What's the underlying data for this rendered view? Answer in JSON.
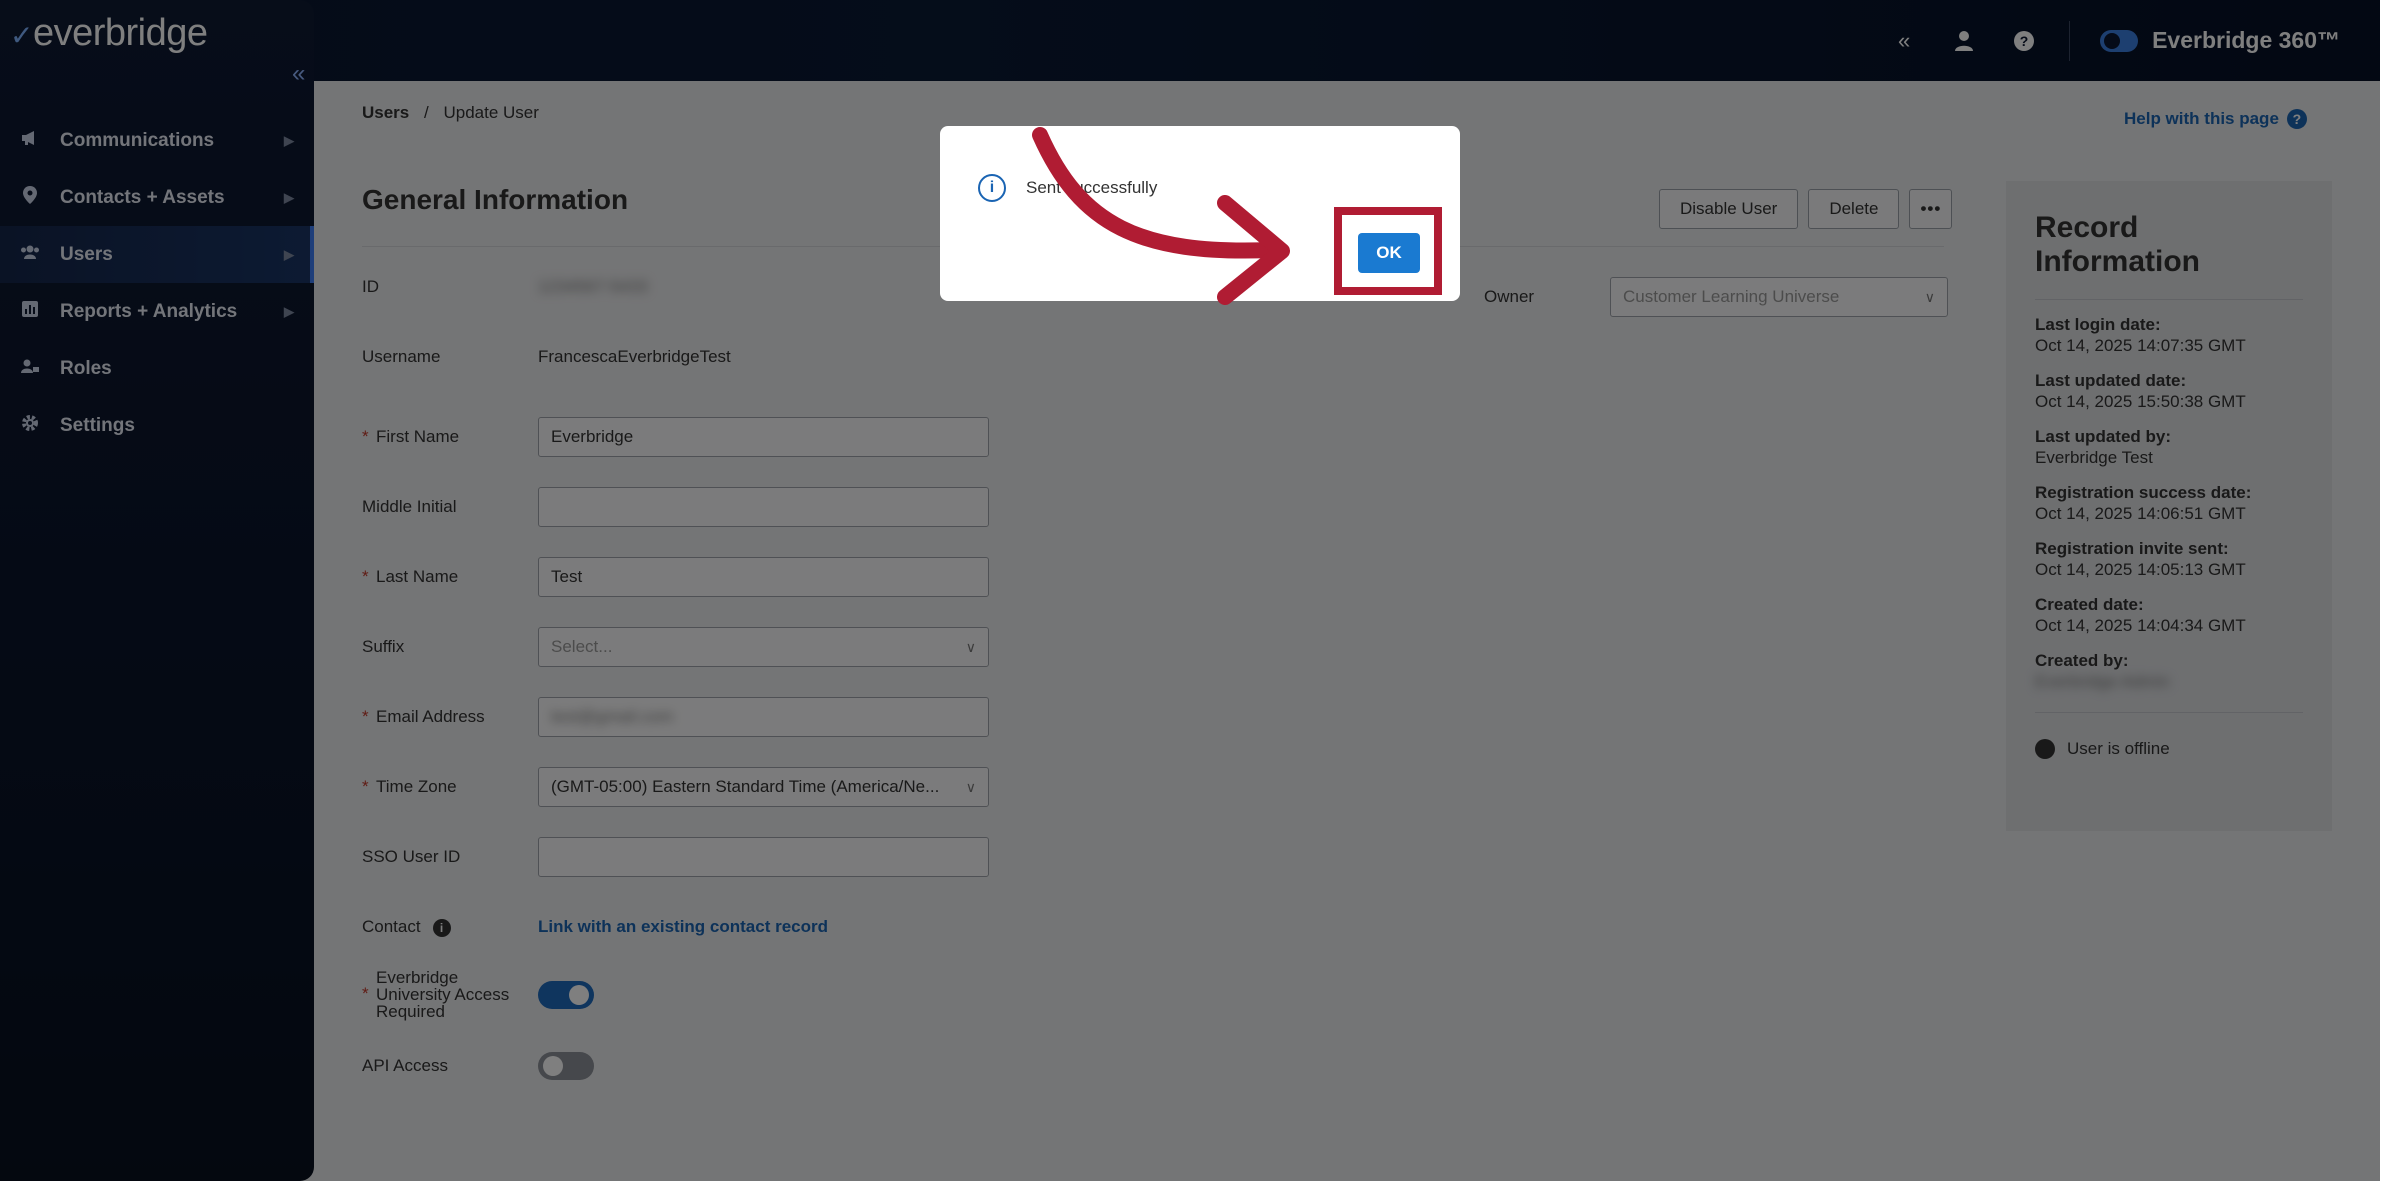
{
  "brand": {
    "logo_text": "everbridge"
  },
  "topbar": {
    "product_label": "Everbridge 360™"
  },
  "sidebar": {
    "items": [
      {
        "label": "Communications",
        "icon": "megaphone-icon",
        "has_children": true
      },
      {
        "label": "Contacts + Assets",
        "icon": "location-pin-icon",
        "has_children": true
      },
      {
        "label": "Users",
        "icon": "users-icon",
        "has_children": true,
        "active": true
      },
      {
        "label": "Reports + Analytics",
        "icon": "chart-icon",
        "has_children": true
      },
      {
        "label": "Roles",
        "icon": "user-role-icon",
        "has_children": false
      },
      {
        "label": "Settings",
        "icon": "gear-icon",
        "has_children": false
      }
    ]
  },
  "breadcrumb": {
    "root": "Users",
    "separator": "/",
    "current": "Update User"
  },
  "help": {
    "label": "Help with this page"
  },
  "section": {
    "title": "General Information"
  },
  "actions": {
    "disable": "Disable User",
    "delete": "Delete",
    "more": "•••"
  },
  "form": {
    "id_label": "ID",
    "id_value": "1234567-5433",
    "owner_label": "Owner",
    "owner_value": "Customer Learning Universe",
    "username_label": "Username",
    "username_value": "FrancescaEverbridgeTest",
    "first_name_label": "First Name",
    "first_name_value": "Everbridge",
    "middle_initial_label": "Middle Initial",
    "middle_initial_value": "",
    "last_name_label": "Last Name",
    "last_name_value": "Test",
    "suffix_label": "Suffix",
    "suffix_placeholder": "Select...",
    "email_label": "Email Address",
    "email_value": "test@gmail.com",
    "timezone_label": "Time Zone",
    "timezone_value": "(GMT-05:00) Eastern Standard Time (America/Ne...",
    "sso_label": "SSO User ID",
    "sso_value": "",
    "contact_label": "Contact",
    "contact_link": "Link with an existing contact record",
    "university_label": "Everbridge University Access Required",
    "university_on": true,
    "api_label": "API Access",
    "api_on": false
  },
  "record": {
    "title": "Record Information",
    "items": [
      {
        "k": "Last login date:",
        "v": "Oct 14, 2025 14:07:35 GMT"
      },
      {
        "k": "Last updated date:",
        "v": "Oct 14, 2025 15:50:38 GMT"
      },
      {
        "k": "Last updated by:",
        "v": "Everbridge Test"
      },
      {
        "k": "Registration success date:",
        "v": "Oct 14, 2025 14:06:51 GMT"
      },
      {
        "k": "Registration invite sent:",
        "v": "Oct 14, 2025 14:05:13 GMT"
      },
      {
        "k": "Created date:",
        "v": "Oct 14, 2025 14:04:34 GMT"
      },
      {
        "k": "Created by:",
        "v": "Everbridge Admin"
      }
    ],
    "status": "User is offline"
  },
  "modal": {
    "message": "Sent successfully",
    "ok_label": "OK"
  },
  "colors": {
    "accent": "#1a7ad1",
    "highlight": "#b01c33",
    "sidebar": "#0e1a33"
  }
}
